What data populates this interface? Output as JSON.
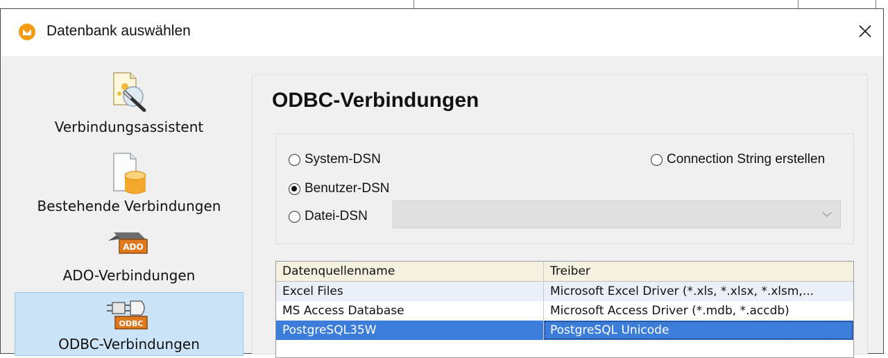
{
  "window": {
    "title": "Datenbank auswählen"
  },
  "nav": {
    "items": [
      {
        "label": "Verbindungsassistent",
        "icon": "wizard-icon",
        "selected": false
      },
      {
        "label": "Bestehende Verbindungen",
        "icon": "database-file-icon",
        "selected": false
      },
      {
        "label": "ADO-Verbindungen",
        "icon": "ado-icon",
        "selected": false
      },
      {
        "label": "ODBC-Verbindungen",
        "icon": "odbc-icon",
        "selected": true
      }
    ]
  },
  "odbc": {
    "heading": "ODBC-Verbindungen",
    "radios": {
      "system_dsn": "System-DSN",
      "user_dsn": "Benutzer-DSN",
      "file_dsn": "Datei-DSN",
      "connection_string": "Connection String erstellen"
    },
    "selected_radio": "Benutzer-DSN",
    "table": {
      "headers": [
        "Datenquellenname",
        "Treiber"
      ],
      "rows": [
        [
          "Excel Files",
          "Microsoft Excel Driver (*.xls, *.xlsx, *.xlsm,..."
        ],
        [
          "MS Access Database",
          "Microsoft Access Driver (*.mdb, *.accdb)"
        ],
        [
          "PostgreSQL35W",
          "PostgreSQL Unicode"
        ]
      ],
      "selected_row": 2
    }
  },
  "colors": {
    "accent": "#3b7dd8",
    "nav_selected": "#cce4f7",
    "app_icon": "#f39c12"
  }
}
